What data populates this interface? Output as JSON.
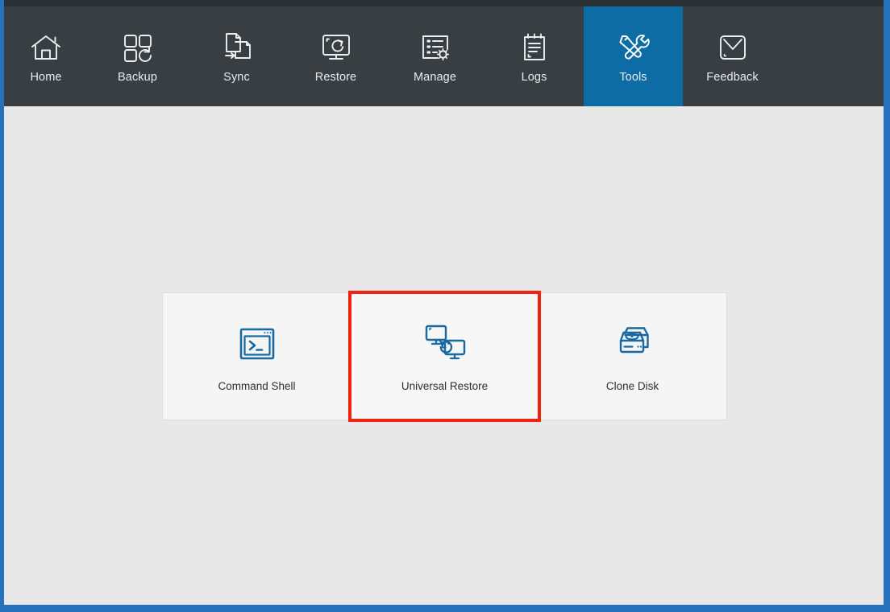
{
  "window": {
    "frame_color": "#2770bb",
    "titlebar_color": "#2b3135",
    "toolbar_color": "#383e42",
    "content_background": "#e8e8e8",
    "accent_color": "#0d6ca4",
    "selection_color": "#f22211"
  },
  "toolbar": {
    "items": [
      {
        "label": "Home",
        "icon": "home-icon",
        "active": false
      },
      {
        "label": "Backup",
        "icon": "backup-icon",
        "active": false
      },
      {
        "label": "Sync",
        "icon": "sync-icon",
        "active": false
      },
      {
        "label": "Restore",
        "icon": "restore-icon",
        "active": false
      },
      {
        "label": "Manage",
        "icon": "manage-icon",
        "active": false
      },
      {
        "label": "Logs",
        "icon": "logs-icon",
        "active": false
      },
      {
        "label": "Tools",
        "icon": "tools-icon",
        "active": true
      },
      {
        "label": "Feedback",
        "icon": "feedback-icon",
        "active": false
      }
    ]
  },
  "tools_page": {
    "cards": [
      {
        "label": "Command Shell",
        "icon": "command-shell-icon",
        "selected": false
      },
      {
        "label": "Universal Restore",
        "icon": "universal-restore-icon",
        "selected": true
      },
      {
        "label": "Clone Disk",
        "icon": "clone-disk-icon",
        "selected": false
      }
    ]
  }
}
